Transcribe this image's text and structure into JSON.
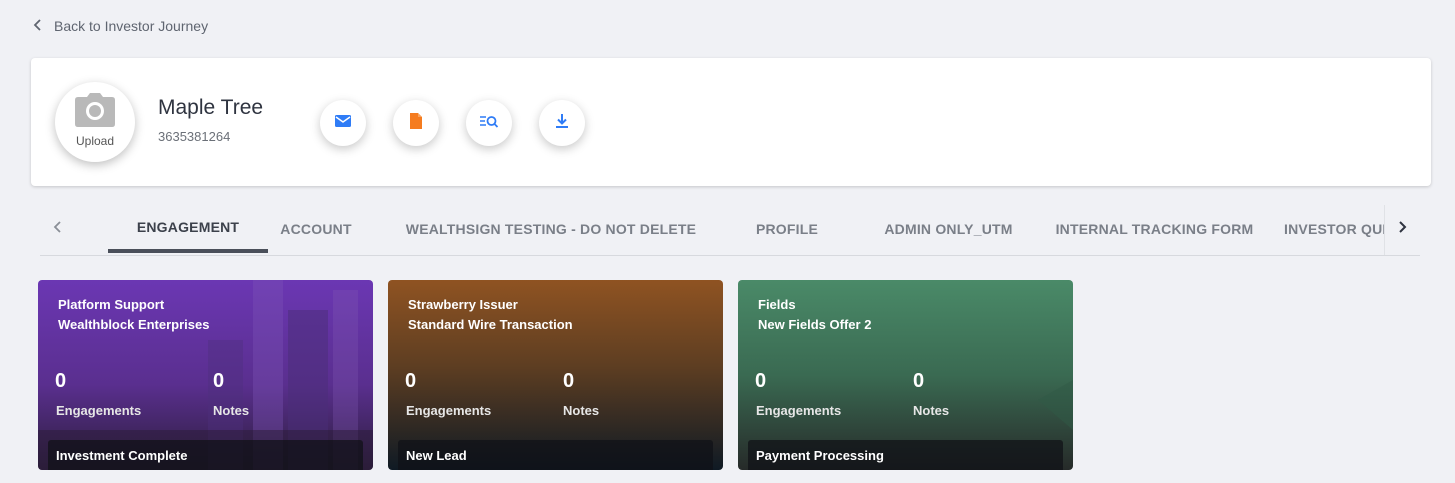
{
  "nav": {
    "back_label": "Back to Investor Journey"
  },
  "profile": {
    "upload_label": "Upload",
    "name": "Maple Tree",
    "phone": "3635381264",
    "actions": [
      {
        "name": "email",
        "icon": "envelope-icon",
        "color": "#2f7cf6"
      },
      {
        "name": "document",
        "icon": "document-icon",
        "color": "#f57c1f"
      },
      {
        "name": "search-list",
        "icon": "list-search-icon",
        "color": "#2f7cf6"
      },
      {
        "name": "download",
        "icon": "download-icon",
        "color": "#2f7cf6"
      }
    ]
  },
  "tabs": [
    {
      "label": "ENGAGEMENT",
      "active": true
    },
    {
      "label": "ACCOUNT"
    },
    {
      "label": "WEALTHSIGN TESTING - DO NOT DELETE"
    },
    {
      "label": "PROFILE"
    },
    {
      "label": "ADMIN ONLY_UTM"
    },
    {
      "label": "INTERNAL TRACKING FORM"
    },
    {
      "label": "INVESTOR QUES"
    }
  ],
  "cards": [
    {
      "title1": "Platform Support",
      "title2": "Wealthblock Enterprises",
      "engagements": "0",
      "engagements_label": "Engagements",
      "notes": "0",
      "notes_label": "Notes",
      "status": "Investment Complete",
      "color": "#5b2fa0"
    },
    {
      "title1": "Strawberry Issuer",
      "title2": "Standard Wire Transaction",
      "engagements": "0",
      "engagements_label": "Engagements",
      "notes": "0",
      "notes_label": "Notes",
      "status": "New Lead",
      "color": "#8a4b1e"
    },
    {
      "title1": "Fields",
      "title2": "New Fields Offer 2",
      "engagements": "0",
      "engagements_label": "Engagements",
      "notes": "0",
      "notes_label": "Notes",
      "status": "Payment Processing",
      "color": "#3f7a5c"
    }
  ]
}
